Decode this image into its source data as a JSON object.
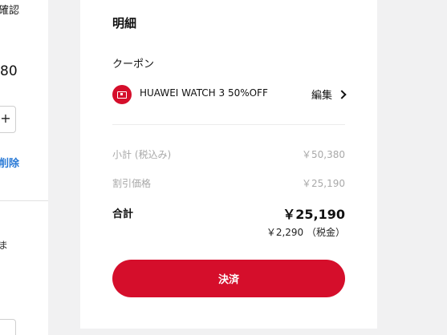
{
  "left_panel": {
    "confirm_text": "確認",
    "price_text": "80",
    "plus_label": "+",
    "delete_text": "削除",
    "more_text": "ま"
  },
  "summary": {
    "title": "明細",
    "coupon_label": "クーポン",
    "coupon_icon": "coupon-tag-icon",
    "coupon_name": "HUAWEI WATCH 3 50%OFF",
    "coupon_edit": "編集",
    "subtotal_label": "小計 (税込み)",
    "subtotal_value": "￥50,380",
    "discount_label": "割引価格",
    "discount_value": "￥25,190",
    "total_label": "合計",
    "total_value": "￥25,190",
    "tax_text": "￥2,290 （税金）",
    "pay_button": "決済"
  },
  "colors": {
    "accent": "#d50e2b",
    "link": "#2a7ad6",
    "muted": "#a9a9a9"
  }
}
